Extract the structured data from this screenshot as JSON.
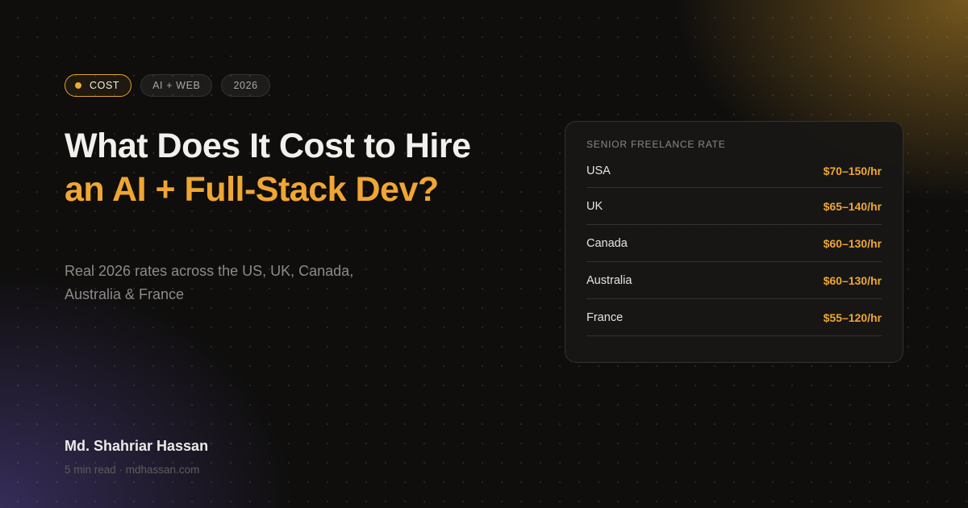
{
  "tags": [
    {
      "label": "COST",
      "active": true
    },
    {
      "label": "AI + WEB",
      "active": false
    },
    {
      "label": "2026",
      "active": false
    }
  ],
  "title": {
    "line1": "What Does It Cost to Hire",
    "line2": "an AI + Full-Stack Dev?"
  },
  "subtitle": "Real 2026 rates across the US, UK, Canada, Australia & France",
  "author": {
    "name": "Md. Shahriar Hassan",
    "meta": "5 min read · mdhassan.com"
  },
  "rates_card": {
    "title": "SENIOR FREELANCE RATE",
    "rows": [
      {
        "country": "USA",
        "rate": "$70–150/hr"
      },
      {
        "country": "UK",
        "rate": "$65–140/hr"
      },
      {
        "country": "Canada",
        "rate": "$60–130/hr"
      },
      {
        "country": "Australia",
        "rate": "$60–130/hr"
      },
      {
        "country": "France",
        "rate": "$55–120/hr"
      }
    ]
  },
  "colors": {
    "accent": "#f0a632",
    "background": "#0f0e0d",
    "text": "#f2f0ec",
    "muted": "#8d8b87"
  }
}
